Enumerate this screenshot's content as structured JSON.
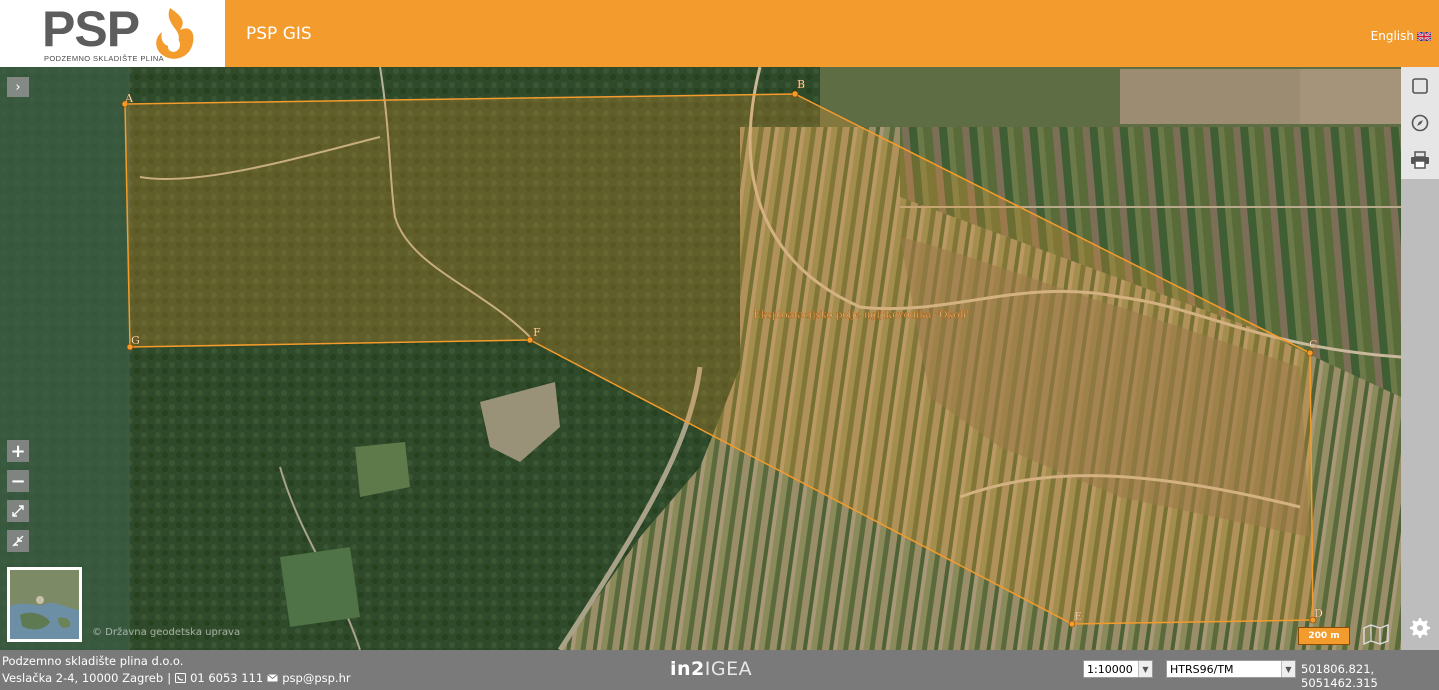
{
  "header": {
    "logo_text": "PSP",
    "logo_subtitle": "PODZEMNO SKLADIŠTE PLINA",
    "app_title": "PSP GIS",
    "language": "English",
    "language_flag_icon": "uk-flag-icon",
    "accent_color": "#f39b2c"
  },
  "map": {
    "expand_icon": "chevron-right-icon",
    "zoom_in": "+",
    "zoom_out": "−",
    "attribution": "© Državna geodetska uprava",
    "polygon_label": "Eksploatacijsko polje ugljikovodika \"Okoli\"",
    "vertices": [
      "A",
      "B",
      "C",
      "D",
      "E",
      "F",
      "G"
    ],
    "scale_label": "200 m",
    "polygon_color": "#f39b2c"
  },
  "tools": [
    {
      "name": "select-box-icon"
    },
    {
      "name": "compass-icon"
    },
    {
      "name": "print-icon"
    },
    {
      "name": "gear-icon"
    }
  ],
  "footer": {
    "company": "Podzemno skladište plina d.o.o.",
    "address": "Veslačka 2-4, 10000 Zagreb",
    "separator": "|",
    "phone": "01 6053 111",
    "email": "psp@psp.hr",
    "brand_left": "in2",
    "brand_right": "IGEA",
    "scale_select": "1:10000",
    "projection_select": "HTRS96/TM",
    "coordinates": "501806.821, 5051462.315"
  }
}
